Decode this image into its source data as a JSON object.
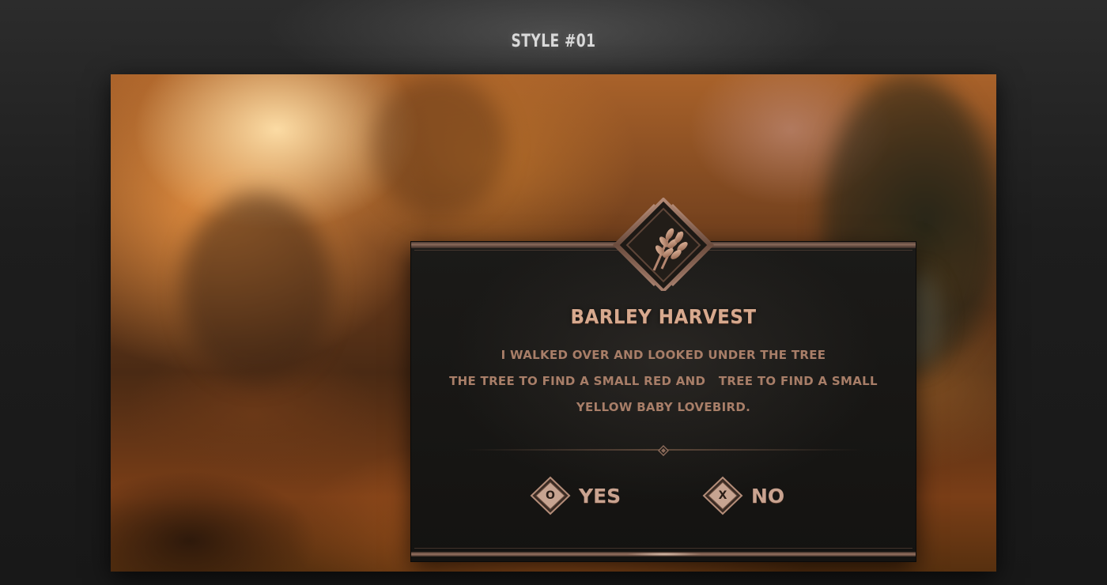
{
  "header": {
    "title": "STYLE #01"
  },
  "dialog": {
    "icon": "wheat-icon",
    "title": "BARLEY HARVEST",
    "body_lines": [
      "I WALKED OVER AND LOOKED UNDER THE TREE",
      "THE TREE TO FIND A SMALL RED AND   TREE TO FIND A SMALL",
      "YELLOW BABY LOVEBIRD."
    ],
    "choices": [
      {
        "key": "O",
        "label": "YES"
      },
      {
        "key": "X",
        "label": "NO"
      }
    ]
  },
  "colors": {
    "accent": "#d7a98e",
    "body_text": "#a87e68",
    "frame": "#8a6a5a",
    "panel": "#161513"
  }
}
